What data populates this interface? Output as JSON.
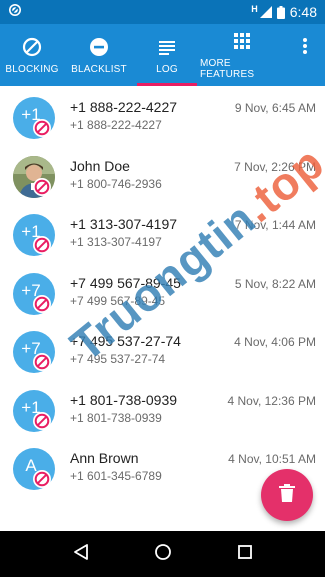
{
  "status_bar": {
    "time": "6:48",
    "network": "H"
  },
  "tabs": [
    {
      "label": "BLOCKING",
      "icon": "block-icon",
      "active": false
    },
    {
      "label": "BLACKLIST",
      "icon": "minus-circle-icon",
      "active": false
    },
    {
      "label": "LOG",
      "icon": "list-icon",
      "active": true
    },
    {
      "label": "MORE FEATURES",
      "icon": "grid-icon",
      "active": false
    }
  ],
  "log": [
    {
      "avatar": "+1",
      "title": "+1 888-222-4227",
      "subtitle": "+1 888-222-4227",
      "time": "9 Nov, 6:45 AM"
    },
    {
      "avatar": "photo",
      "title": "John Doe",
      "subtitle": "+1 800-746-2936",
      "time": "7 Nov, 2:26 PM"
    },
    {
      "avatar": "+1",
      "title": "+1 313-307-4197",
      "subtitle": "+1 313-307-4197",
      "time": "7 Nov, 1:44 AM"
    },
    {
      "avatar": "+7",
      "title": "+7 499 567-89-45",
      "subtitle": "+7 499 567-89-45",
      "time": "5 Nov, 8:22 AM"
    },
    {
      "avatar": "+7",
      "title": "+7 495 537-27-74",
      "subtitle": "+7 495 537-27-74",
      "time": "4 Nov, 4:06 PM"
    },
    {
      "avatar": "+1",
      "title": "+1 801-738-0939",
      "subtitle": "+1 801-738-0939",
      "time": "4 Nov, 12:36 PM"
    },
    {
      "avatar": "A",
      "title": "Ann Brown",
      "subtitle": "+1 601-345-6789",
      "time": "4 Nov, 10:51 AM"
    }
  ],
  "watermark": {
    "main": "Truongtin",
    "dot": ".",
    "ext": "top"
  },
  "colors": {
    "status_bar": "#0a73b8",
    "tab_bar": "#1a8ad4",
    "tab_indicator": "#e91e63",
    "avatar": "#4aaee8",
    "block_badge": "#e91e63",
    "fab": "#e4306a"
  }
}
